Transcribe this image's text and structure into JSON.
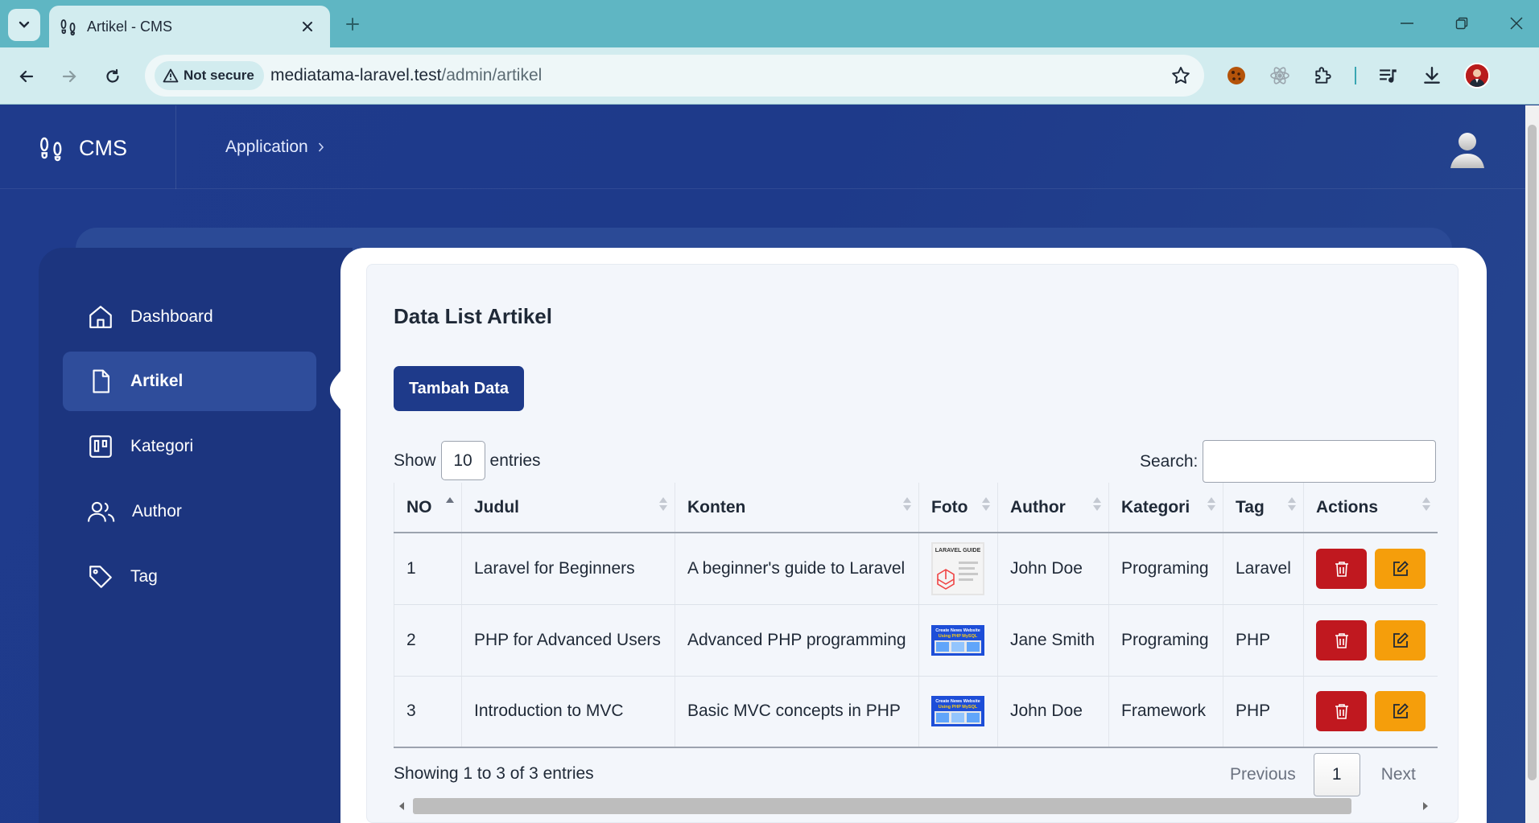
{
  "browser": {
    "tab_title": "Artikel - CMS",
    "security_label": "Not secure",
    "url_host": "mediatama-laravel.test",
    "url_path": "/admin/artikel"
  },
  "app": {
    "brand": "CMS",
    "breadcrumb": "Application"
  },
  "sidebar": {
    "items": [
      {
        "label": "Dashboard",
        "icon": "home-icon",
        "active": false
      },
      {
        "label": "Artikel",
        "icon": "document-icon",
        "active": true
      },
      {
        "label": "Kategori",
        "icon": "kanban-icon",
        "active": false
      },
      {
        "label": "Author",
        "icon": "users-icon",
        "active": false
      },
      {
        "label": "Tag",
        "icon": "tag-icon",
        "active": false
      }
    ]
  },
  "main": {
    "title": "Data List Artikel",
    "add_button": "Tambah Data",
    "show_label": "Show",
    "entries_value": "10",
    "entries_label": "entries",
    "search_label": "Search:",
    "search_value": "",
    "table": {
      "columns": [
        "NO",
        "Judul",
        "Konten",
        "Foto",
        "Author",
        "Kategori",
        "Tag",
        "Actions"
      ],
      "rows": [
        {
          "no": "1",
          "judul": "Laravel for Beginners",
          "konten": "A beginner's guide to Laravel",
          "foto": "laravel-guide-thumbnail",
          "author": "John Doe",
          "kategori": "Programing",
          "tag": "Laravel"
        },
        {
          "no": "2",
          "judul": "PHP for Advanced Users",
          "konten": "Advanced PHP programming",
          "foto": "php-mysql-news-website-thumbnail",
          "author": "Jane Smith",
          "kategori": "Programing",
          "tag": "PHP"
        },
        {
          "no": "3",
          "judul": "Introduction to MVC",
          "konten": "Basic MVC concepts in PHP",
          "foto": "php-mysql-news-website-thumbnail",
          "author": "John Doe",
          "kategori": "Framework",
          "tag": "PHP"
        }
      ]
    },
    "info": "Showing 1 to 3 of 3 entries",
    "pagination": {
      "previous": "Previous",
      "current": "1",
      "next": "Next"
    }
  },
  "thumbnails": {
    "laravel_caption": "LARAVEL GUIDE",
    "php_caption_1": "Create News Website",
    "php_caption_2": "Using PHP MySQL"
  },
  "colors": {
    "primary": "#1e3a8a",
    "delete": "#c0181f",
    "edit": "#f59e0b",
    "chrome": "#5fb6c3"
  }
}
